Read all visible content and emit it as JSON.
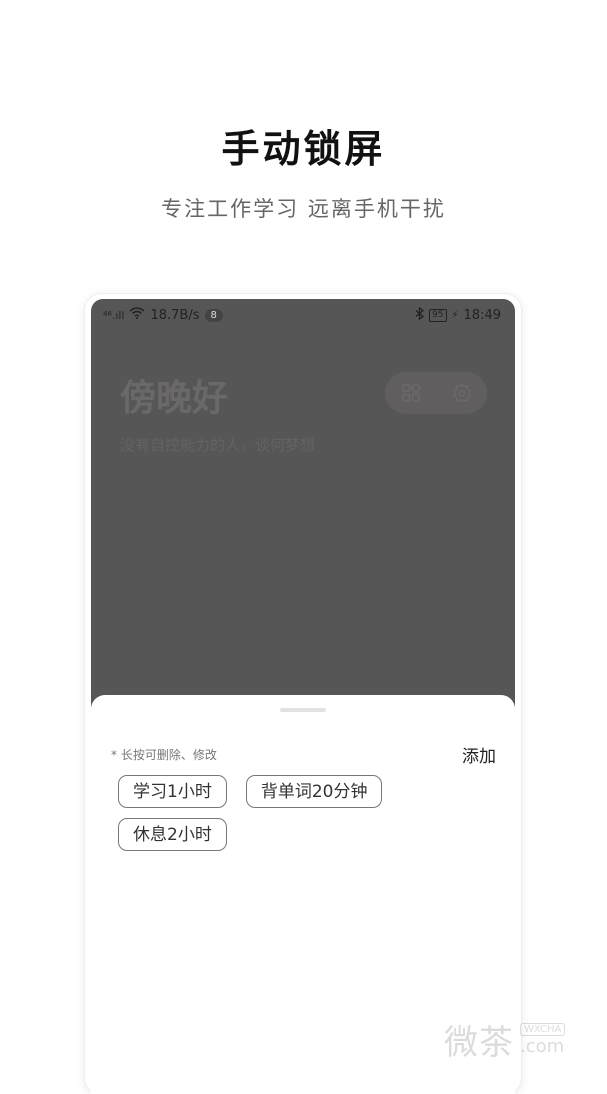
{
  "promo": {
    "title": "手动锁屏",
    "subtitle": "专注工作学习 远离手机干扰"
  },
  "statusbar": {
    "signal": "⁴⁶.ıll",
    "speed": "18.7B/s",
    "badge": "8",
    "battery": "95",
    "time": "18:49"
  },
  "home": {
    "greeting": "傍晚好",
    "motto": "没有自控能力的人，谈何梦想",
    "icons": [
      "grid-icon",
      "gear-icon"
    ]
  },
  "sheet": {
    "hint": "* 长按可删除、修改",
    "add_label": "添加",
    "chips": [
      "学习1小时",
      "背单词20分钟",
      "休息2小时"
    ]
  },
  "watermark": {
    "main": "微茶",
    "tag": "WXCHA",
    "domain": ".com"
  }
}
